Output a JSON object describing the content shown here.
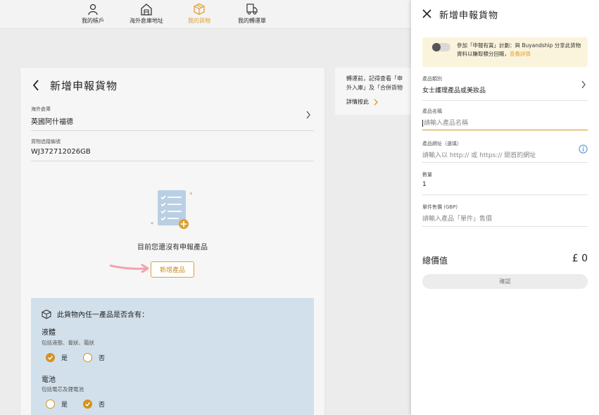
{
  "nav": {
    "items": [
      {
        "label": "我的帳戶",
        "icon": "user-icon"
      },
      {
        "label": "海外倉庫地址",
        "icon": "warehouse-icon"
      },
      {
        "label": "我的貨物",
        "icon": "box-icon"
      },
      {
        "label": "我的轉運單",
        "icon": "truck-doc-icon"
      }
    ],
    "active_index": 2
  },
  "card": {
    "title": "新增申報貨物",
    "warehouse": {
      "label": "海外倉庫",
      "value": "英國阿什福德"
    },
    "tracking": {
      "label": "貨物追蹤編號",
      "value": "WJ372712026GB"
    },
    "empty_text": "目前您還沒有申報產品",
    "add_button": "新增產品",
    "questions": {
      "title": "此貨物內任一產品是否含有：",
      "items": [
        {
          "label": "液體",
          "sub": "包括液態、膏狀、霜狀",
          "yes": "是",
          "no": "否",
          "selected": "yes"
        },
        {
          "label": "電池",
          "sub": "包括電芯及鋰電池",
          "yes": "是",
          "no": "否",
          "selected": "no"
        }
      ]
    }
  },
  "notice": {
    "line1": "轉運前，記得查看「申",
    "line2": "外入庫」及「合併貨物",
    "link": "詳情按此"
  },
  "panel": {
    "title": "新增申報貨物",
    "promo": {
      "text": "參加「申報有賞」計劃：與 Buyandship 分享此貨物資料以賺取積分回贈，",
      "link": "查看詳情",
      "toggle_on": false
    },
    "category": {
      "label": "產品類別",
      "value": "女士護理產品或美妝品"
    },
    "name": {
      "label": "產品名稱",
      "placeholder": "請輸入產品名稱"
    },
    "url": {
      "label": "產品網址（選填）",
      "placeholder": "請輸入以 http:// 或 https:// 開首的網址"
    },
    "qty": {
      "label": "數量",
      "value": "1"
    },
    "price": {
      "label": "單件售價 (GBP)",
      "placeholder": "請輸入產品「單件」售價"
    },
    "total_label": "總價值",
    "total_value": "£ 0",
    "confirm": "確認"
  },
  "colors": {
    "accent": "#e0a030",
    "info_bg": "#d2e0eb",
    "promo_bg": "#fbf4dd"
  }
}
